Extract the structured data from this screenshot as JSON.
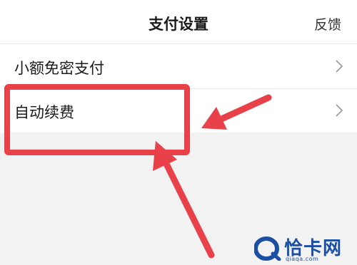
{
  "navbar": {
    "title": "支付设置",
    "feedback_label": "反馈"
  },
  "settings_list": [
    {
      "label": "小额免密支付"
    },
    {
      "label": "自动续费"
    }
  ],
  "annotation": {
    "highlight_color": "#e8414a",
    "target_item": "自动续费"
  },
  "watermark": {
    "brand": "恰卡网",
    "domain": "qiaqa.com"
  },
  "colors": {
    "background": "#f2f2f2",
    "surface": "#ffffff",
    "text": "#1a1a1a",
    "watermark": "#1b4fa3"
  }
}
